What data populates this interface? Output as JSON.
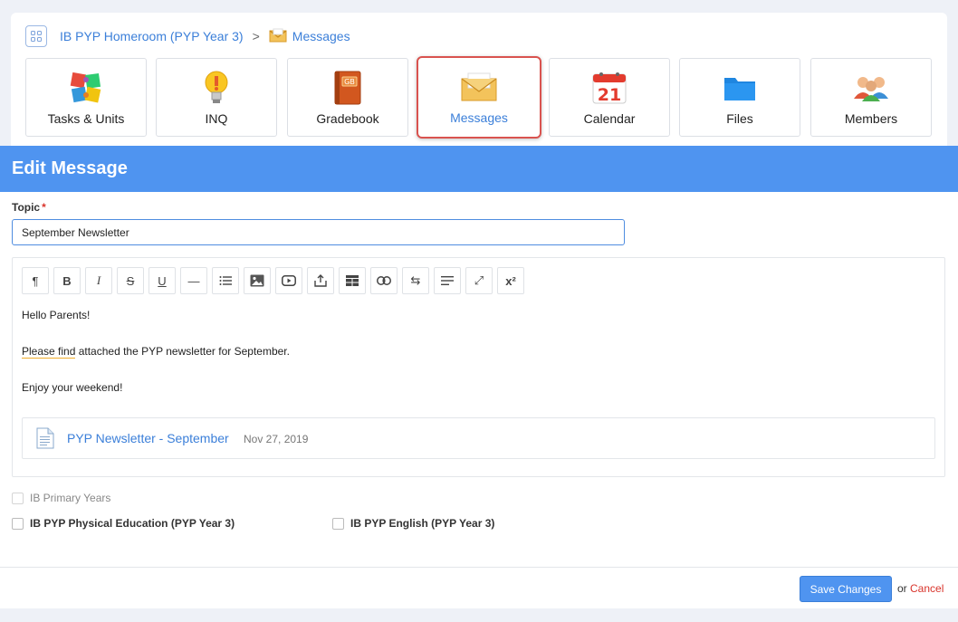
{
  "breadcrumb": {
    "class_name": "IB PYP Homeroom (PYP Year 3)",
    "separator": ">",
    "current": "Messages"
  },
  "tiles": [
    {
      "label": "Tasks & Units",
      "icon": "puzzle-icon",
      "active": false
    },
    {
      "label": "INQ",
      "icon": "lightbulb-icon",
      "active": false
    },
    {
      "label": "Gradebook",
      "icon": "gradebook-icon",
      "active": false
    },
    {
      "label": "Messages",
      "icon": "envelope-icon",
      "active": true
    },
    {
      "label": "Calendar",
      "icon": "calendar-icon",
      "active": false
    },
    {
      "label": "Files",
      "icon": "folder-icon",
      "active": false
    },
    {
      "label": "Members",
      "icon": "members-icon",
      "active": false
    }
  ],
  "calendar_day": "21",
  "gradebook_badge": "GB",
  "header": {
    "title": "Edit Message"
  },
  "topic": {
    "label": "Topic",
    "required_mark": "*",
    "value": "September Newsletter"
  },
  "toolbar": [
    {
      "name": "paragraph-icon",
      "glyph": "¶"
    },
    {
      "name": "bold-icon",
      "glyph": "B"
    },
    {
      "name": "italic-icon",
      "glyph": "I"
    },
    {
      "name": "strikethrough-icon",
      "glyph": "S"
    },
    {
      "name": "underline-icon",
      "glyph": "U"
    },
    {
      "name": "horizontal-rule-icon",
      "glyph": "—"
    },
    {
      "name": "list-icon",
      "glyph": "≡"
    },
    {
      "name": "image-icon",
      "glyph": ""
    },
    {
      "name": "video-icon",
      "glyph": ""
    },
    {
      "name": "upload-icon",
      "glyph": ""
    },
    {
      "name": "table-icon",
      "glyph": ""
    },
    {
      "name": "link-icon",
      "glyph": ""
    },
    {
      "name": "swap-icon",
      "glyph": "⇆"
    },
    {
      "name": "align-icon",
      "glyph": ""
    },
    {
      "name": "fullscreen-icon",
      "glyph": "⤢"
    },
    {
      "name": "superscript-icon",
      "glyph": "x²"
    }
  ],
  "message": {
    "line1": "Hello Parents!",
    "line2_spell": "Please find",
    "line2_rest": " attached the PYP newsletter for September.",
    "line3": "Enjoy your weekend!"
  },
  "attachment": {
    "name": "PYP Newsletter - September",
    "date": "Nov 27, 2019"
  },
  "checkboxes": {
    "group": "IB Primary Years",
    "option1": "IB PYP Physical Education (PYP Year 3)",
    "option2": "IB PYP English (PYP Year 3)"
  },
  "footer": {
    "save_label": "Save Changes",
    "or_text": "or",
    "cancel_label": "Cancel"
  },
  "colors": {
    "accent": "#4f94f0",
    "link": "#3b7fd9",
    "danger": "#d9342b"
  }
}
